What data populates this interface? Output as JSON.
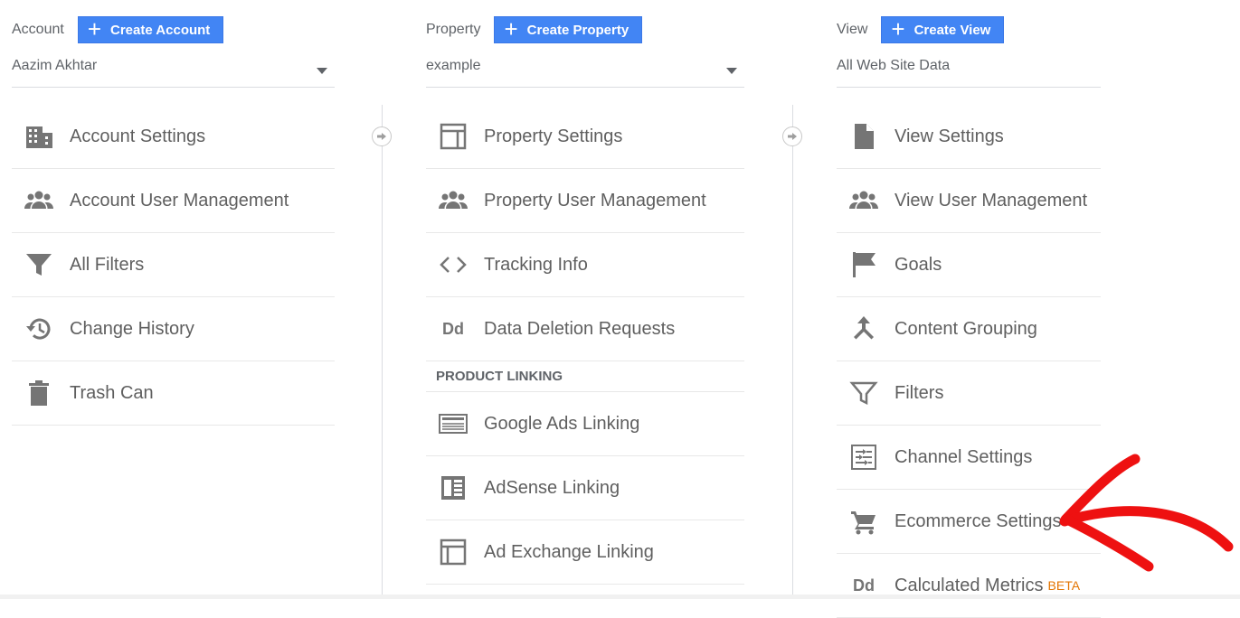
{
  "account": {
    "label": "Account",
    "create_label": "Create Account",
    "selected": "Aazim Akhtar",
    "items": [
      {
        "label": "Account Settings",
        "icon": "building-icon"
      },
      {
        "label": "Account User Management",
        "icon": "people-icon"
      },
      {
        "label": "All Filters",
        "icon": "filter-icon"
      },
      {
        "label": "Change History",
        "icon": "history-icon"
      },
      {
        "label": "Trash Can",
        "icon": "trash-icon"
      }
    ]
  },
  "property": {
    "label": "Property",
    "create_label": "Create Property",
    "selected": "example",
    "items": [
      {
        "label": "Property Settings",
        "icon": "window-icon"
      },
      {
        "label": "Property User Management",
        "icon": "people-icon"
      },
      {
        "label": "Tracking Info",
        "icon": "code-icon"
      },
      {
        "label": "Data Deletion Requests",
        "icon": "dd-icon",
        "icon_text": "Dd"
      }
    ],
    "section_heading": "PRODUCT LINKING",
    "linking_items": [
      {
        "label": "Google Ads Linking",
        "icon": "ads-icon"
      },
      {
        "label": "AdSense Linking",
        "icon": "adsense-icon"
      },
      {
        "label": "Ad Exchange Linking",
        "icon": "window-icon"
      }
    ]
  },
  "view": {
    "label": "View",
    "create_label": "Create View",
    "selected": "All Web Site Data",
    "items": [
      {
        "label": "View Settings",
        "icon": "document-icon"
      },
      {
        "label": "View User Management",
        "icon": "people-icon"
      },
      {
        "label": "Goals",
        "icon": "flag-icon"
      },
      {
        "label": "Content Grouping",
        "icon": "grouping-icon"
      },
      {
        "label": "Filters",
        "icon": "filter-icon"
      },
      {
        "label": "Channel Settings",
        "icon": "channel-icon"
      },
      {
        "label": "Ecommerce Settings",
        "icon": "cart-icon"
      },
      {
        "label": "Calculated Metrics",
        "icon": "dd-icon",
        "icon_text": "Dd",
        "badge": "BETA"
      }
    ]
  },
  "colors": {
    "button_blue": "#4285f4",
    "beta_orange": "#e37400",
    "annotation_red": "#ee1111"
  }
}
